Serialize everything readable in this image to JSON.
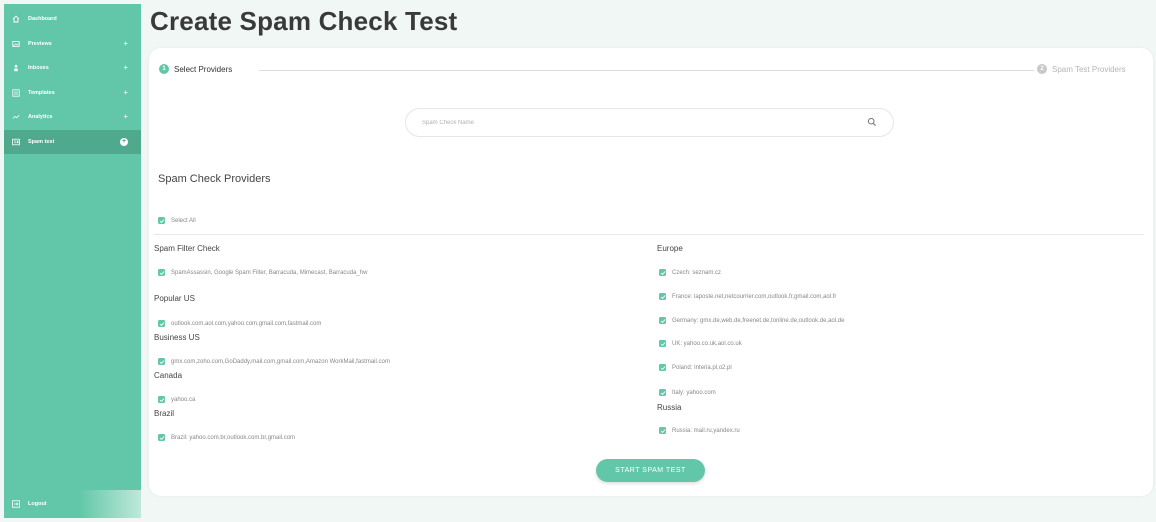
{
  "sidebar": {
    "items": [
      {
        "label": "Dashboard",
        "icon": "home-icon",
        "plus": ""
      },
      {
        "label": "Previews",
        "icon": "image-icon",
        "plus": "+"
      },
      {
        "label": "Inboxes",
        "icon": "person-icon",
        "plus": "+"
      },
      {
        "label": "Templates",
        "icon": "template-icon",
        "plus": "+"
      },
      {
        "label": "Analytics",
        "icon": "analytics-icon",
        "plus": "+"
      },
      {
        "label": "Spam test",
        "icon": "spam-test-icon",
        "plus": "+"
      }
    ],
    "logout": {
      "label": "Logout",
      "icon": "logout-icon"
    }
  },
  "page": {
    "title": "Create Spam Check Test"
  },
  "steps": [
    {
      "number": "1",
      "label": "Select Providers"
    },
    {
      "number": "2",
      "label": "Spam Test Providers"
    }
  ],
  "search": {
    "placeholder": "Spam Check Name"
  },
  "providers": {
    "title": "Spam Check Providers",
    "select_all": "Select All",
    "left": {
      "spam_filter_title": "Spam Filter Check",
      "spam_filter_item": "SpamAssassin, Google Spam Filter, Barracuda, Mimecast, Barracuda_hw",
      "popular_us_title": "Popular US",
      "popular_us_item": "outlook.com,aol.com,yahoo.com,gmail.com,fastmail.com",
      "business_us_title": "Business US",
      "business_us_item": "gmx.com,zoho.com,GoDaddy,mail.com,gmail.com,Amazon WorkMail,fastmail.com",
      "canada_title": "Canada",
      "canada_item": "yahoo.ca",
      "brazil_title": "Brazil",
      "brazil_item": "Brazil: yahoo.com.br,outlook.com.br,gmail.com"
    },
    "right": {
      "europe_title": "Europe",
      "czech": "Czech: seznam.cz",
      "france": "France: laposte.net,netcourrier.com,outlook.fr,gmail.com,aol.fr",
      "germany": "Germany: gmx.de,web.de,freenet.de,tonline.de,outlook.de,aol.de",
      "uk": "UK: yahoo.co.uk,aol.co.uk",
      "poland": "Poland: Interia.pl,o2.pl",
      "italy": "Italy: yahoo.com",
      "russia_title": "Russia",
      "russia": "Russia: mail.ru,yandex.ru"
    }
  },
  "actions": {
    "start": "START SPAM TEST"
  },
  "colors": {
    "accent": "#62c7a8",
    "sidebar_active": "#4fa98d"
  }
}
